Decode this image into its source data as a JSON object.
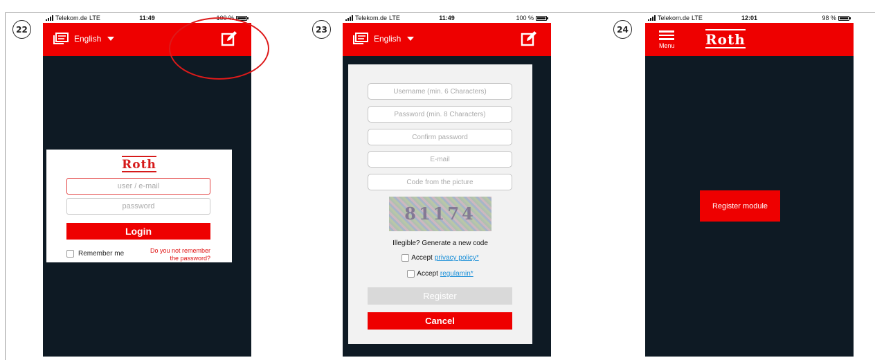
{
  "steps": [
    "22",
    "23",
    "24"
  ],
  "status_bars": [
    {
      "carrier": "Telekom.de",
      "network": "LTE",
      "time": "11:49",
      "battery": "100 %",
      "battery_level": 1.0
    },
    {
      "carrier": "Telekom.de",
      "network": "LTE",
      "time": "11:49",
      "battery": "100 %",
      "battery_level": 1.0
    },
    {
      "carrier": "Telekom.de",
      "network": "LTE",
      "time": "12:01",
      "battery": "98 %",
      "battery_level": 0.98
    }
  ],
  "language": {
    "label": "English"
  },
  "brand": {
    "logo_text": "Roth"
  },
  "login": {
    "user_placeholder": "user / e-mail",
    "password_placeholder": "password",
    "login_label": "Login",
    "remember_label": "Remember me",
    "forgot_line1": "Do you not remember",
    "forgot_line2": "the password?"
  },
  "register": {
    "username_placeholder": "Username (min. 6 Characters)",
    "password_placeholder": "Password (min. 8 Characters)",
    "confirm_placeholder": "Confirm password",
    "email_placeholder": "E-mail",
    "code_placeholder": "Code from the picture",
    "captcha_code": "81174",
    "illegible_text": "Illegible? Generate a new code",
    "accept_label": "Accept",
    "privacy_link": "privacy policy*",
    "regulamin_link": "regulamin*",
    "register_label": "Register",
    "cancel_label": "Cancel"
  },
  "home": {
    "menu_label": "Menu",
    "register_module_label": "Register module"
  },
  "colors": {
    "brand_red": "#ee0000",
    "dark_bg": "#0e1a24",
    "link_blue": "#1a8fd8"
  }
}
